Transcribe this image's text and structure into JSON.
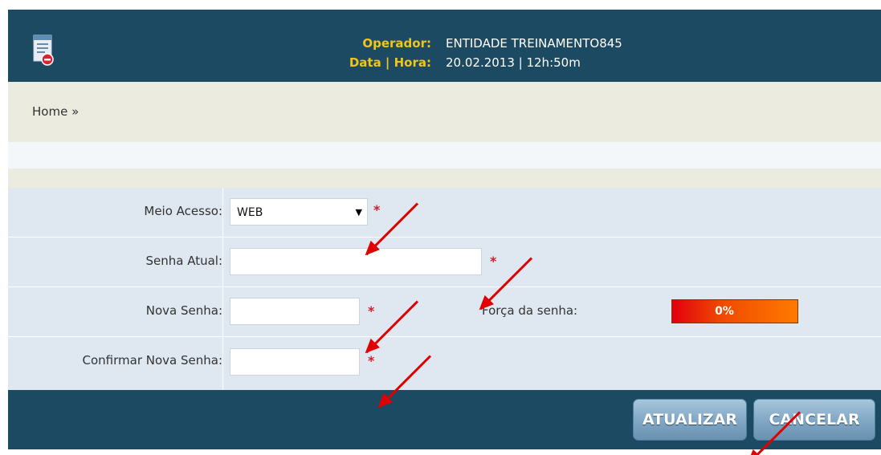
{
  "header": {
    "operator_label": "Operador:",
    "operator_value": "ENTIDADE TREINAMENTO845",
    "datetime_label": "Data | Hora:",
    "datetime_value": "20.02.2013 | 12h:50m"
  },
  "breadcrumb": "Home »",
  "form": {
    "access": {
      "label": "Meio Acesso:",
      "selected": "WEB"
    },
    "current_password": {
      "label": "Senha Atual:",
      "value": ""
    },
    "new_password": {
      "label": "Nova Senha:",
      "value": ""
    },
    "confirm_password": {
      "label": "Confirmar Nova Senha:",
      "value": ""
    },
    "required_mark": "*",
    "strength": {
      "label": "Força da senha:",
      "value_text": "0%",
      "level": 0
    }
  },
  "buttons": {
    "update": "ATUALIZAR",
    "cancel": "CANCELAR"
  },
  "colors": {
    "header_bg": "#1d4a63",
    "label_accent": "#f0c419",
    "annotation_arrow": "#e00000",
    "required": "#d0202a"
  }
}
